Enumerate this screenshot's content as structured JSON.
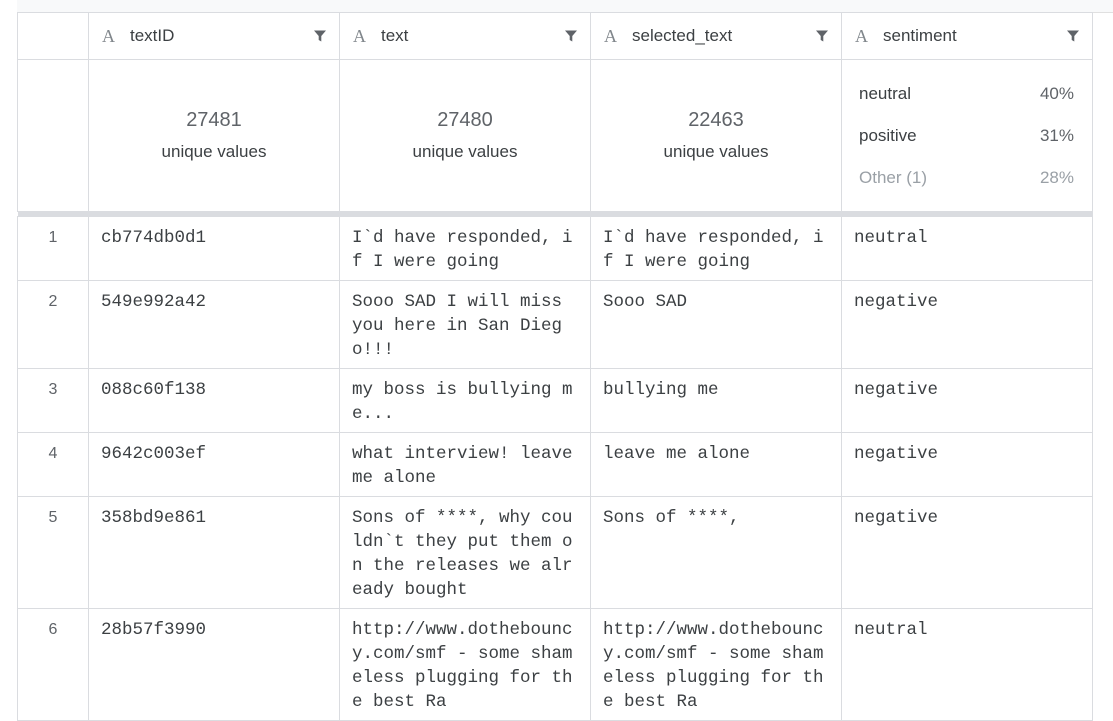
{
  "columns": [
    {
      "name": "textID",
      "type_icon": "A"
    },
    {
      "name": "text",
      "type_icon": "A"
    },
    {
      "name": "selected_text",
      "type_icon": "A"
    },
    {
      "name": "sentiment",
      "type_icon": "A"
    }
  ],
  "summary": {
    "textID": {
      "count": "27481",
      "label": "unique values"
    },
    "text": {
      "count": "27480",
      "label": "unique values"
    },
    "selected_text": {
      "count": "22463",
      "label": "unique values"
    },
    "sentiment": [
      {
        "label": "neutral",
        "pct": "40%"
      },
      {
        "label": "positive",
        "pct": "31%"
      },
      {
        "label": "Other (1)",
        "pct": "28%"
      }
    ]
  },
  "rows": [
    {
      "idx": "1",
      "textID": "cb774db0d1",
      "text": "I`d have responded, if I were going",
      "selected_text": "I`d have responded, if I were going",
      "sentiment": "neutral"
    },
    {
      "idx": "2",
      "textID": "549e992a42",
      "text": "Sooo SAD I will miss you here in San Diego!!!",
      "selected_text": "Sooo SAD",
      "sentiment": "negative"
    },
    {
      "idx": "3",
      "textID": "088c60f138",
      "text": "my boss is bullying me...",
      "selected_text": "bullying me",
      "sentiment": "negative"
    },
    {
      "idx": "4",
      "textID": "9642c003ef",
      "text": "what interview! leave me alone",
      "selected_text": "leave me alone",
      "sentiment": "negative"
    },
    {
      "idx": "5",
      "textID": "358bd9e861",
      "text": "Sons of ****, why couldn`t they put them on the releases we already bought",
      "selected_text": "Sons of ****,",
      "sentiment": "negative"
    },
    {
      "idx": "6",
      "textID": "28b57f3990",
      "text": "http://www.dothebouncy.com/smf - some shameless plugging for the best Ra",
      "selected_text": "http://www.dothebouncy.com/smf - some shameless plugging for the best Ra",
      "sentiment": "neutral"
    }
  ]
}
